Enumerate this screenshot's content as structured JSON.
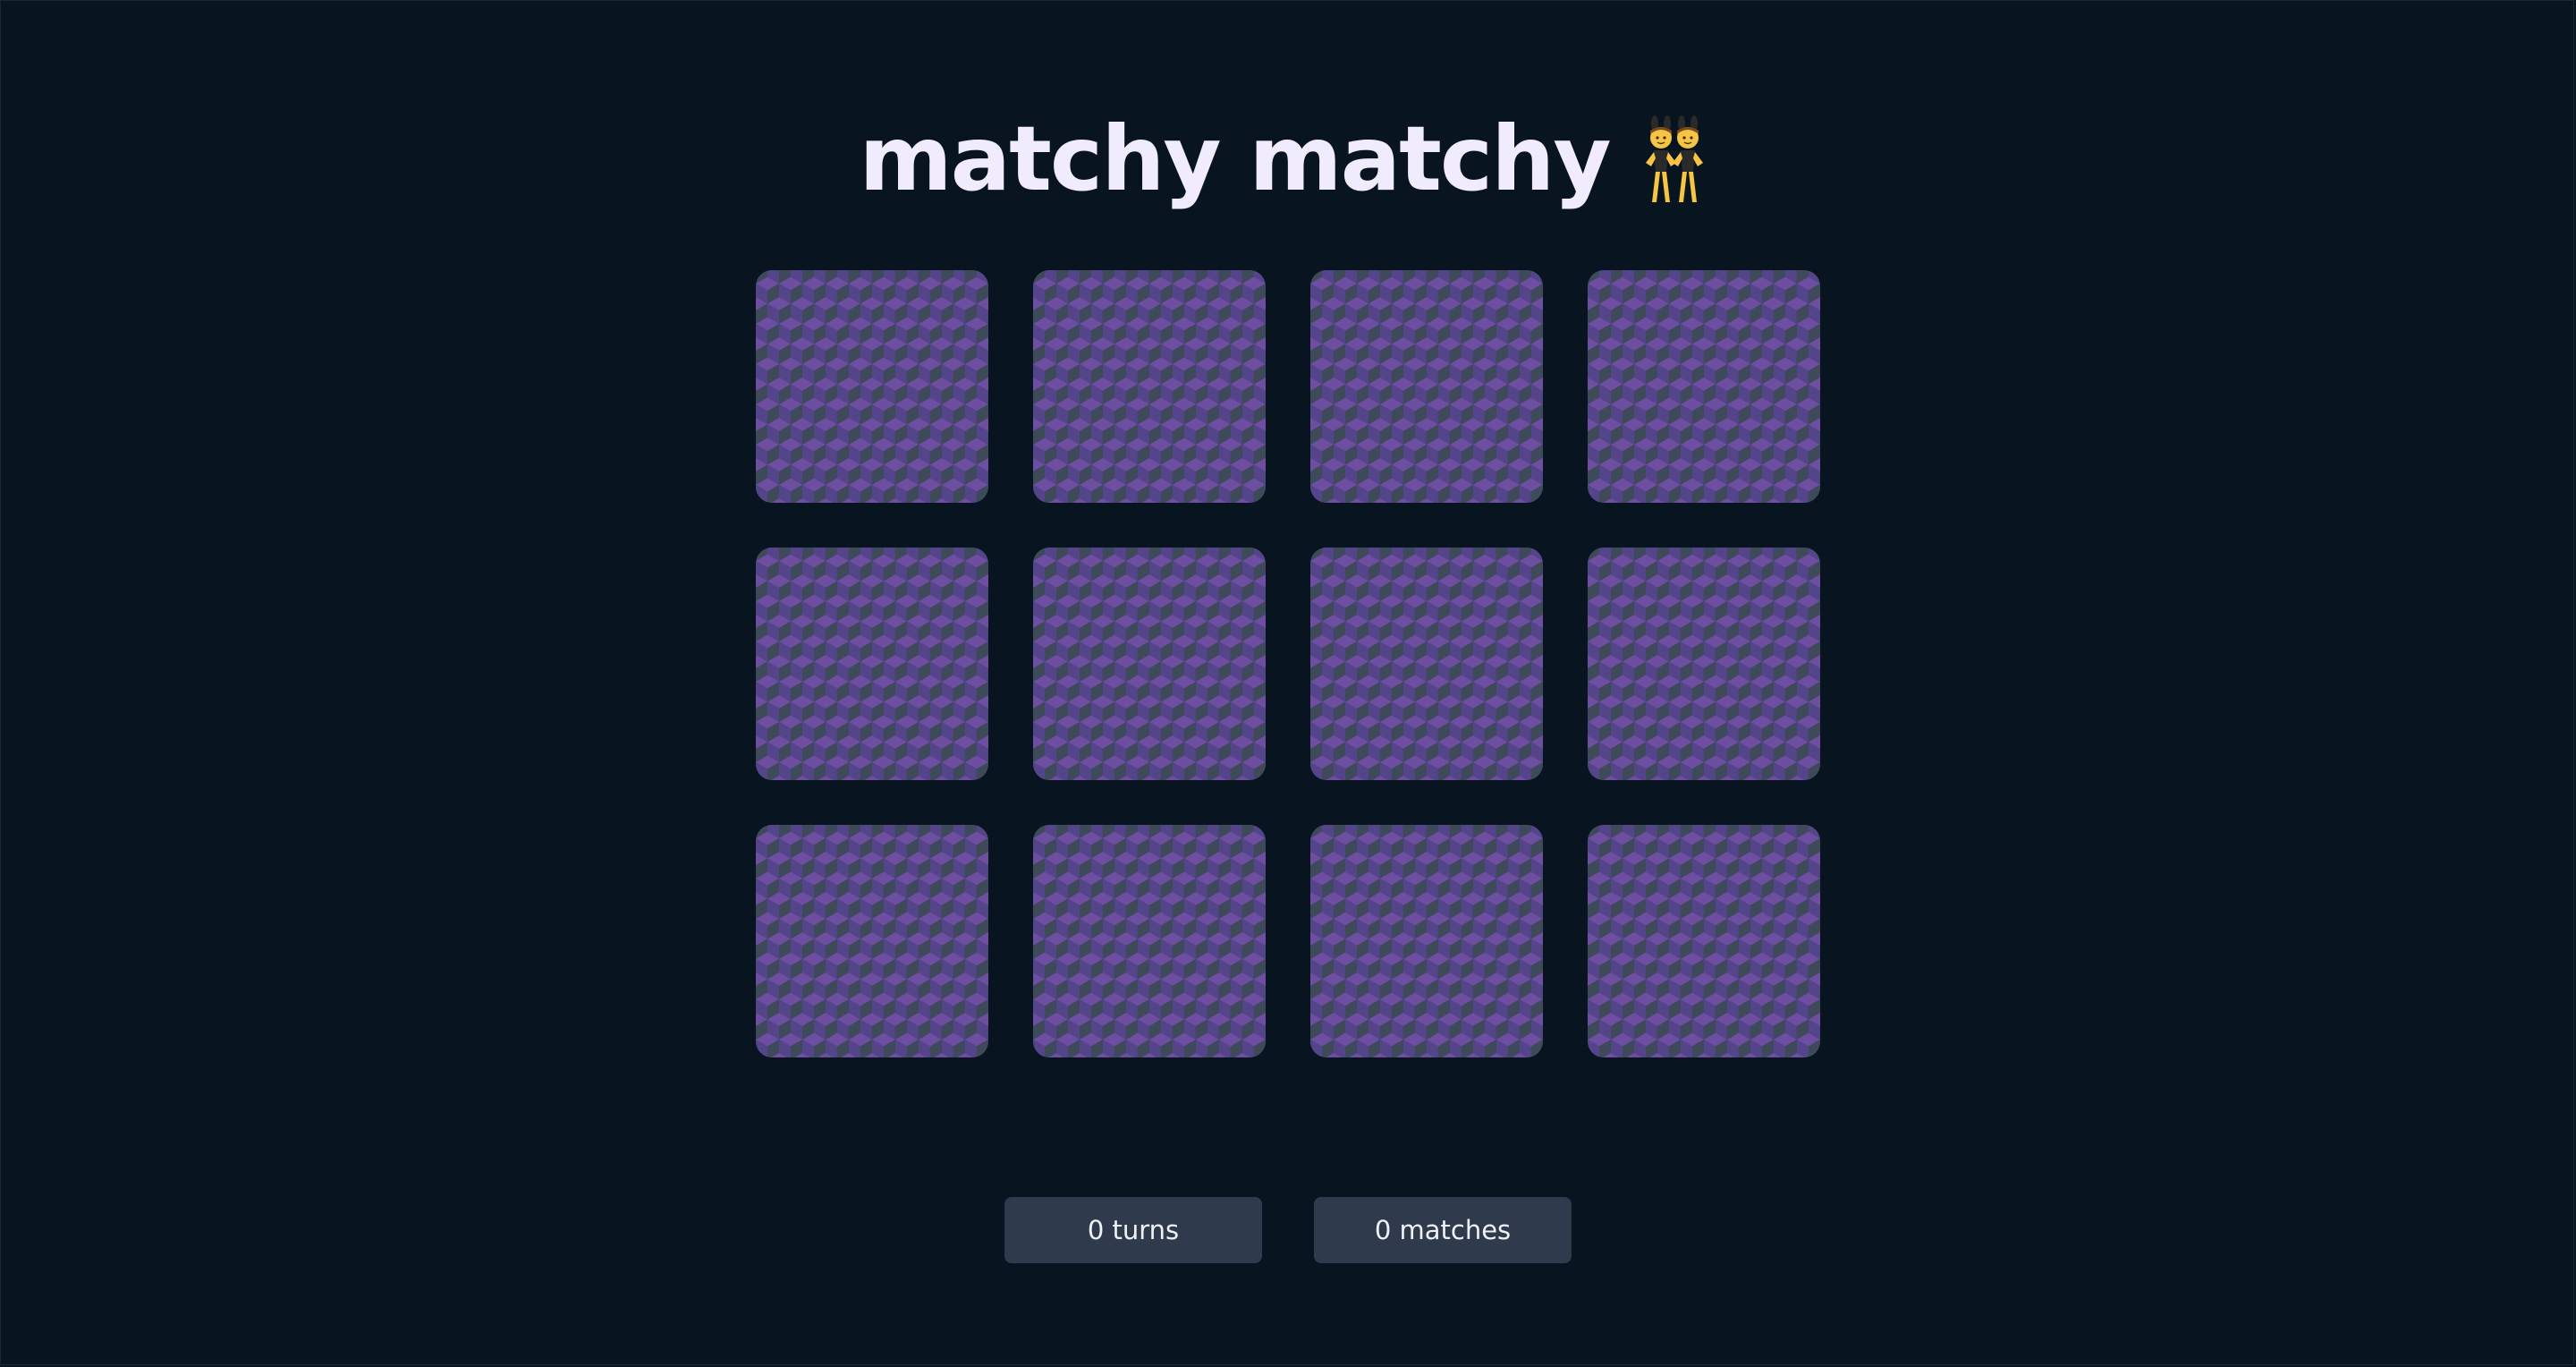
{
  "header": {
    "title": "matchy matchy",
    "emoji_icon": "women-with-bunny-ears-icon"
  },
  "board": {
    "rows": 3,
    "columns": 4,
    "card_back_colors": {
      "top": "#6d4ea0",
      "left": "#54458a",
      "right": "#3e4a5a"
    },
    "cards": [
      {
        "state": "face-down"
      },
      {
        "state": "face-down"
      },
      {
        "state": "face-down"
      },
      {
        "state": "face-down"
      },
      {
        "state": "face-down"
      },
      {
        "state": "face-down"
      },
      {
        "state": "face-down"
      },
      {
        "state": "face-down"
      },
      {
        "state": "face-down"
      },
      {
        "state": "face-down"
      },
      {
        "state": "face-down"
      },
      {
        "state": "face-down"
      }
    ]
  },
  "stats": {
    "turns_label": "0 turns",
    "matches_label": "0 matches"
  },
  "colors": {
    "background": "#08141f",
    "title": "#f1ecfb",
    "counter_bg": "#2f3b4c",
    "counter_text": "#eef1f6"
  }
}
